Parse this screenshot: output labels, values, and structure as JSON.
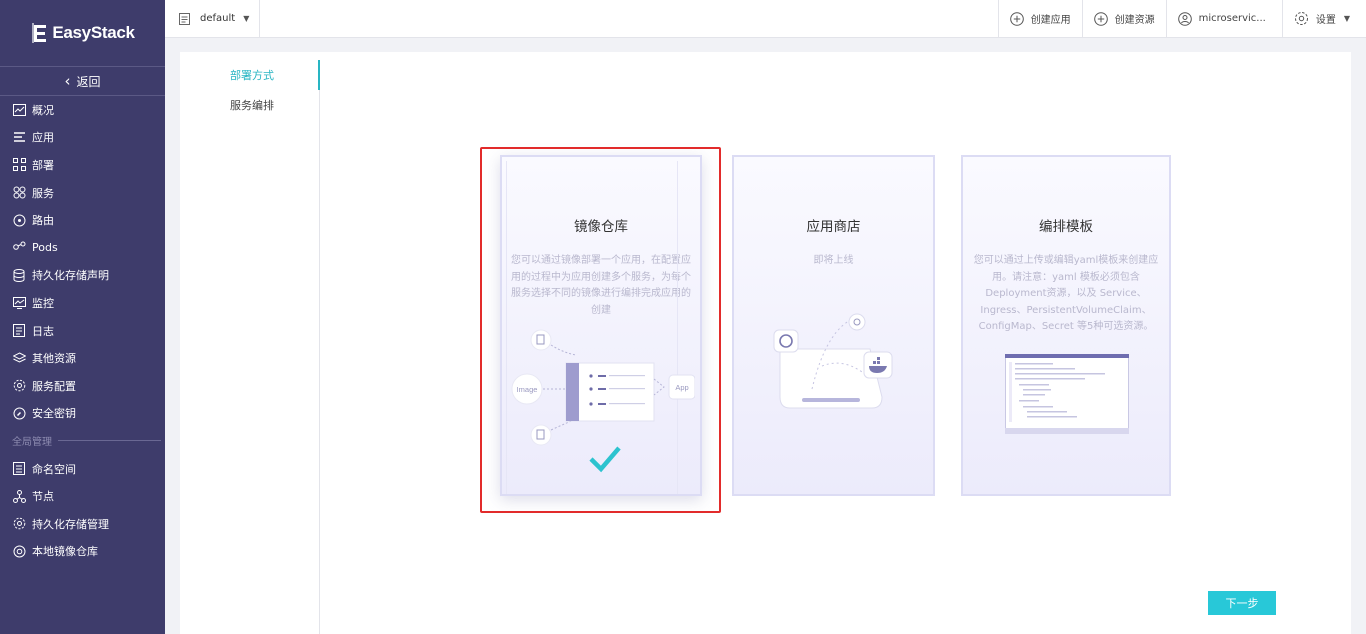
{
  "sidebar": {
    "brand": "EasyStack",
    "back_label": "返回",
    "items": [
      {
        "label": "概况",
        "icon": "chart-icon"
      },
      {
        "label": "应用",
        "icon": "list-icon"
      },
      {
        "label": "部署",
        "icon": "deploy-icon"
      },
      {
        "label": "服务",
        "icon": "service-icon"
      },
      {
        "label": "路由",
        "icon": "route-icon"
      },
      {
        "label": "Pods",
        "icon": "pods-icon"
      },
      {
        "label": "持久化存储声明",
        "icon": "storage-icon"
      },
      {
        "label": "监控",
        "icon": "monitor-icon"
      },
      {
        "label": "日志",
        "icon": "log-icon"
      },
      {
        "label": "其他资源",
        "icon": "layers-icon"
      },
      {
        "label": "服务配置",
        "icon": "config-icon"
      },
      {
        "label": "安全密钥",
        "icon": "key-icon"
      }
    ],
    "section_label": "全局管理",
    "global_items": [
      {
        "label": "命名空间",
        "icon": "namespace-icon"
      },
      {
        "label": "节点",
        "icon": "node-icon"
      },
      {
        "label": "持久化存储管理",
        "icon": "gear-icon"
      },
      {
        "label": "本地镜像仓库",
        "icon": "registry-icon"
      }
    ]
  },
  "topbar": {
    "namespace": "default",
    "create_app": "创建应用",
    "create_resource": "创建资源",
    "user": "microservic...",
    "settings": "设置"
  },
  "subnav": {
    "items": [
      {
        "label": "部署方式",
        "active": true
      },
      {
        "label": "服务编排",
        "active": false
      }
    ]
  },
  "cards": [
    {
      "title": "镜像仓库",
      "desc": "您可以通过镜像部署一个应用，在配置应用的过程中为应用创建多个服务，为每个服务选择不同的镜像进行编排完成应用的创建",
      "selected": true
    },
    {
      "title": "应用商店",
      "desc": "即将上线",
      "selected": false
    },
    {
      "title": "编排模板",
      "desc": "您可以通过上传或编辑yaml模板来创建应用。请注意：yaml 模板必须包含 Deployment资源，以及 Service、Ingress、PersistentVolumeClaim、ConfigMap、Secret 等5种可选资源。",
      "selected": false
    }
  ],
  "diagram": {
    "image_label": "Image",
    "app_label": "App"
  },
  "next_label": "下一步",
  "colors": {
    "sidebar_bg": "#3e3c6b",
    "accent": "#28c8d8",
    "selection": "#e22b2b"
  }
}
